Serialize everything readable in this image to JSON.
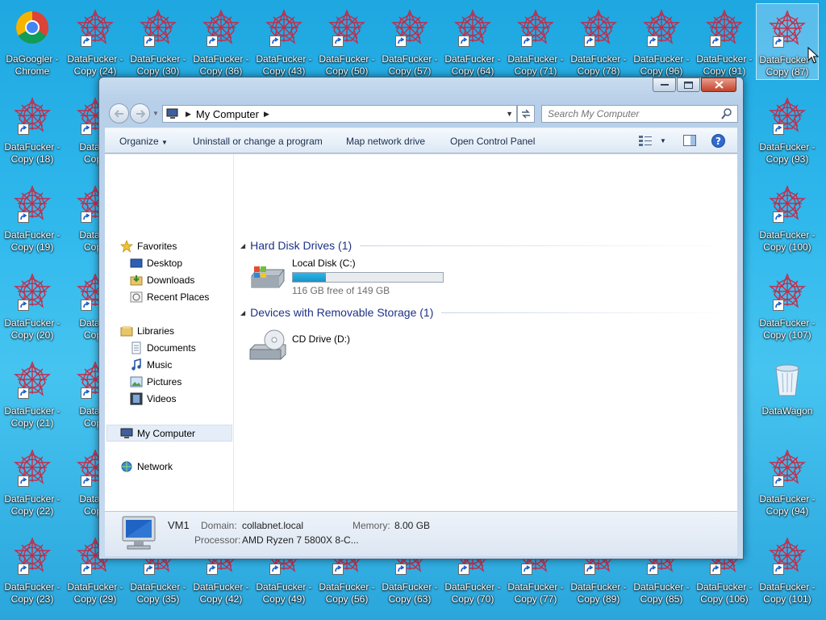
{
  "desktop": {
    "top_row": [
      {
        "label": "DaGoogler -\nChrome",
        "icon": "chrome-icon"
      },
      {
        "label": "DataFucker -\nCopy (24)"
      },
      {
        "label": "DataFucker -\nCopy (30)"
      },
      {
        "label": "DataFucker -\nCopy (36)"
      },
      {
        "label": "DataFucker -\nCopy (43)"
      },
      {
        "label": "DataFucker -\nCopy (50)"
      },
      {
        "label": "DataFucker -\nCopy (57)"
      },
      {
        "label": "DataFucker -\nCopy (64)"
      },
      {
        "label": "DataFucker -\nCopy (71)"
      },
      {
        "label": "DataFucker -\nCopy (78)"
      },
      {
        "label": "DataFucker -\nCopy (96)"
      },
      {
        "label": "DataFucker -\nCopy (91)"
      },
      {
        "label": "DataFucker -\nCopy (87)",
        "selected": true
      }
    ],
    "left_col": [
      {
        "label": "DataFucker -\nCopy (18)"
      },
      {
        "label": "DataFucker -\nCopy (19)"
      },
      {
        "label": "DataFucker -\nCopy (20)"
      },
      {
        "label": "DataFucker -\nCopy (21)"
      },
      {
        "label": "DataFucker -\nCopy (22)"
      },
      {
        "label": "DataFucker -\nCopy (23)"
      }
    ],
    "second_col": [
      {
        "label": "DataFu\nCopy"
      },
      {
        "label": "DataFu\nCopy"
      },
      {
        "label": "DataFu\nCopy"
      },
      {
        "label": "DataFu\nCopy"
      },
      {
        "label": "DataFu\nCopy"
      }
    ],
    "right_col": [
      {
        "label": "DataFucker -\nCopy (93)"
      },
      {
        "label": "DataFucker -\nCopy (100)"
      },
      {
        "label": "DataFucker -\nCopy (107)"
      },
      {
        "label": "DataWagon",
        "icon": "recycle-bin-icon"
      },
      {
        "label": "DataFucker -\nCopy (94)"
      },
      {
        "label": "DataFucker -\nCopy (101)"
      }
    ],
    "bottom_row": [
      {
        "label": "DataFucker -\nCopy (29)"
      },
      {
        "label": "DataFucker -\nCopy (35)"
      },
      {
        "label": "DataFucker -\nCopy (42)"
      },
      {
        "label": "DataFucker -\nCopy (49)"
      },
      {
        "label": "DataFucker -\nCopy (56)"
      },
      {
        "label": "DataFucker -\nCopy (63)"
      },
      {
        "label": "DataFucker -\nCopy (70)"
      },
      {
        "label": "DataFucker -\nCopy (77)"
      },
      {
        "label": "DataFucker -\nCopy (89)"
      },
      {
        "label": "DataFucker -\nCopy (85)"
      },
      {
        "label": "DataFucker -\nCopy (106)"
      }
    ]
  },
  "window": {
    "address": {
      "crumb": "My Computer"
    },
    "search": {
      "placeholder": "Search My Computer"
    },
    "toolbar": {
      "organize": "Organize",
      "uninstall": "Uninstall or change a program",
      "map_drive": "Map network drive",
      "control_panel": "Open Control Panel"
    },
    "nav": {
      "favorites": "Favorites",
      "desktop": "Desktop",
      "downloads": "Downloads",
      "recent": "Recent Places",
      "libraries": "Libraries",
      "documents": "Documents",
      "music": "Music",
      "pictures": "Pictures",
      "videos": "Videos",
      "my_computer": "My Computer",
      "network": "Network"
    },
    "groups": {
      "hdd": "Hard Disk Drives (1)",
      "removable": "Devices with Removable Storage (1)"
    },
    "drives": {
      "c": {
        "name": "Local Disk (C:)",
        "free": "116 GB free of 149 GB",
        "used_fraction": 0.22
      },
      "d": {
        "name": "CD Drive (D:)"
      }
    },
    "details": {
      "computer_name": "VM1",
      "domain_label": "Domain:",
      "domain": "collabnet.local",
      "memory_label": "Memory:",
      "memory": "8.00 GB",
      "processor_label": "Processor:",
      "processor": "AMD Ryzen 7 5800X 8-C..."
    }
  },
  "colors": {
    "desktop_bg": "#2fb8ec",
    "group_header": "#1e3287",
    "drive_bar": "#1792c7"
  }
}
